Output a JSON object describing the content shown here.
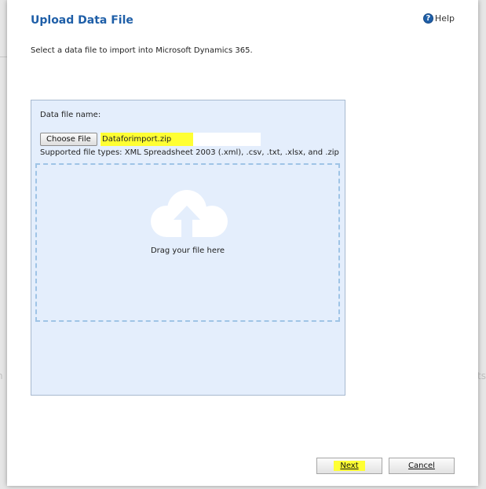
{
  "dialog": {
    "title": "Upload Data File",
    "help_label": "Help",
    "subtitle": "Select a data file to import into Microsoft Dynamics 365."
  },
  "upload": {
    "field_label": "Data file name:",
    "choose_button": "Choose File",
    "file_name": "Dataforimport.zip",
    "supported_types": "Supported file types: XML Spreadsheet 2003 (.xml), .csv, .txt, .xlsx, and .zip",
    "drag_text": "Drag your file here"
  },
  "footer": {
    "next_label": "Next",
    "cancel_label": "Cancel"
  },
  "backdrop": {
    "left_fragment": "n",
    "right_fragment": "rts"
  },
  "colors": {
    "title": "#1f5fa8",
    "panel_bg": "#e4eefc",
    "highlight": "#ffff33",
    "dropzone_border": "#9fc4e6"
  },
  "icons": {
    "help": "help-question-icon",
    "upload": "cloud-upload-icon"
  }
}
